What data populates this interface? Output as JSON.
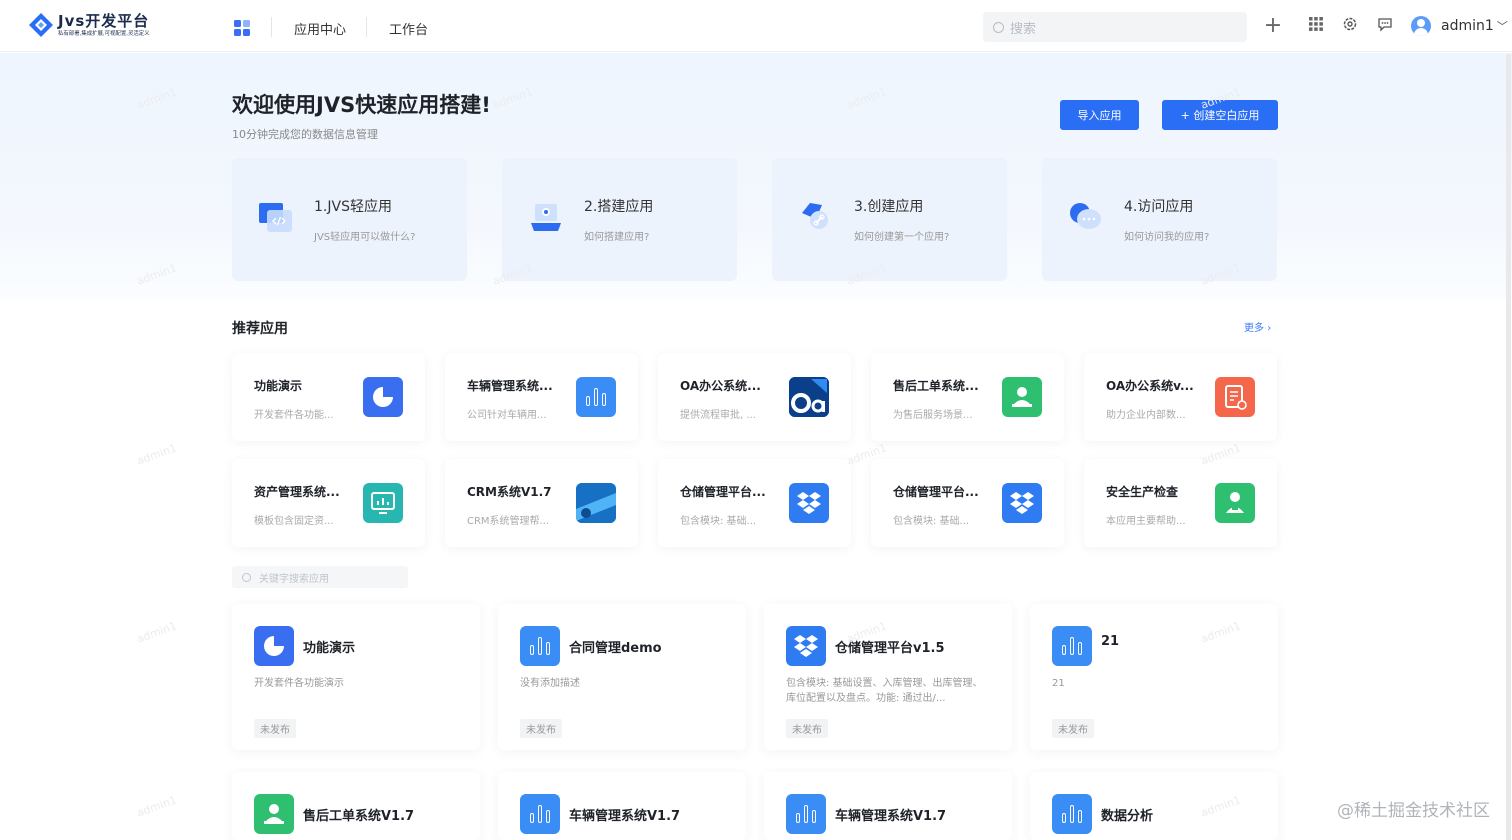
{
  "header": {
    "logo_title": "Jvs开发平台",
    "logo_subtitle": "私有部署,集成扩展,可视配置,灵活定义",
    "nav": [
      "应用中心",
      "工作台"
    ],
    "search_placeholder": "搜索",
    "username": "admin1"
  },
  "hero": {
    "title": "欢迎使用JVS快速应用搭建!",
    "subtitle": "10分钟完成您的数据信息管理",
    "import_button": "导入应用",
    "create_button": "+ 创建空白应用",
    "guides": [
      {
        "title": "1.JVS轻应用",
        "desc": "JVS轻应用可以做什么?",
        "icon": "code-window-icon"
      },
      {
        "title": "2.搭建应用",
        "desc": "如何搭建应用?",
        "icon": "laptop-icon"
      },
      {
        "title": "3.创建应用",
        "desc": "如何创建第一个应用?",
        "icon": "link-shape-icon"
      },
      {
        "title": "4.访问应用",
        "desc": "如何访问我的应用?",
        "icon": "chat-bubble-icon"
      }
    ]
  },
  "recommended": {
    "title": "推荐应用",
    "more": "更多",
    "items": [
      {
        "name": "功能演示",
        "desc": "开发套件各功能...",
        "icon": "pie-chart-icon",
        "color": "#3a6ef0"
      },
      {
        "name": "车辆管理系统...",
        "desc": "公司针对车辆用...",
        "icon": "bar-chart-icon",
        "color": "#3a8df5"
      },
      {
        "name": "OA办公系统...",
        "desc": "提供流程审批, ...",
        "icon": "oa-logo-icon",
        "color": "#0e5fb8"
      },
      {
        "name": "售后工单系统...",
        "desc": "为售后服务场景...",
        "icon": "person-desk-icon",
        "color": "#2fbf71"
      },
      {
        "name": "OA办公系统v...",
        "desc": "助力企业内部数...",
        "icon": "document-icon",
        "color": "#f5674b"
      },
      {
        "name": "资产管理系统...",
        "desc": "模板包含固定资...",
        "icon": "monitor-icon",
        "color": "#27b7b0"
      },
      {
        "name": "CRM系统V1.7",
        "desc": "CRM系统管理帮...",
        "icon": "crm-logo-icon",
        "color": "#1c8fe0"
      },
      {
        "name": "仓储管理平台...",
        "desc": "包含模块: 基础...",
        "icon": "dropbox-icon",
        "color": "#2f7cf2"
      },
      {
        "name": "仓储管理平台...",
        "desc": "包含模块: 基础...",
        "icon": "dropbox-icon",
        "color": "#2f7cf2"
      },
      {
        "name": "安全生产检查",
        "desc": "本应用主要帮助...",
        "icon": "person-check-icon",
        "color": "#2fbf71"
      }
    ]
  },
  "apps": {
    "search_placeholder": "关键字搜索应用",
    "items": [
      {
        "name": "功能演示",
        "desc": "开发套件各功能演示",
        "status": "未发布",
        "icon": "pie-chart-icon"
      },
      {
        "name": "合同管理demo",
        "desc": "没有添加描述",
        "status": "未发布",
        "icon": "bar-chart-icon"
      },
      {
        "name": "仓储管理平台v1.5",
        "desc": "包含模块: 基础设置、入库管理、出库管理、库位配置以及盘点。功能: 通过出/...",
        "status": "未发布",
        "icon": "dropbox-icon"
      },
      {
        "name": "21",
        "desc": "21",
        "status": "未发布",
        "icon": "bar-chart-icon"
      },
      {
        "name": "售后工单系统V1.7",
        "desc": "",
        "status": "",
        "icon": "person-desk-icon"
      },
      {
        "name": "车辆管理系统V1.7",
        "desc": "",
        "status": "",
        "icon": "bar-chart-icon"
      },
      {
        "name": "车辆管理系统V1.7",
        "desc": "",
        "status": "",
        "icon": "bar-chart-icon"
      },
      {
        "name": "数据分析",
        "desc": "",
        "status": "",
        "icon": "bar-chart-icon"
      }
    ]
  },
  "watermark_user": "admin1",
  "site_watermark": "@稀土掘金技术社区"
}
